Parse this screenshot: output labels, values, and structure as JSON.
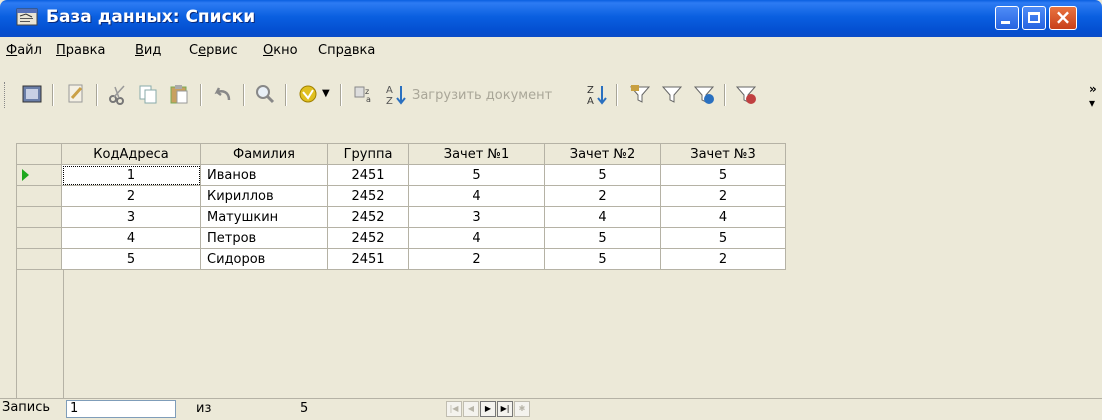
{
  "window": {
    "title": "База данных: Списки"
  },
  "menu": [
    {
      "label": "Файл",
      "accel": "Ф",
      "rest": "айл"
    },
    {
      "label": "Правка",
      "accel": "П",
      "rest": "равка"
    },
    {
      "label": "Вид",
      "accel": "В",
      "rest": "ид"
    },
    {
      "label": "Сервис",
      "pre": "С",
      "accel": "е",
      "rest": "рвис"
    },
    {
      "label": "Окно",
      "accel": "О",
      "rest": "кно"
    },
    {
      "label": "Справка",
      "pre": "Спр",
      "accel": "а",
      "rest": "вка"
    }
  ],
  "toolbar": {
    "load_document_label": "Загрузить документ"
  },
  "table": {
    "columns": [
      "КодАдреса",
      "Фамилия",
      "Группа",
      "Зачет №1",
      "Зачет №2",
      "Зачет №3"
    ],
    "rows": [
      [
        "1",
        "Иванов",
        "2451",
        "5",
        "5",
        "5"
      ],
      [
        "2",
        "Кириллов",
        "2452",
        "4",
        "2",
        "2"
      ],
      [
        "3",
        "Матушкин",
        "2452",
        "3",
        "4",
        "4"
      ],
      [
        "4",
        "Петров",
        "2452",
        "4",
        "5",
        "5"
      ],
      [
        "5",
        "Сидоров",
        "2451",
        "2",
        "5",
        "2"
      ]
    ]
  },
  "navigator": {
    "record_label": "Запись",
    "current_record": "1",
    "of_label": "из",
    "total": "5"
  },
  "colors": {
    "titlebar": "#0a5fe0",
    "window_bg": "#ece9d8",
    "current_row_marker": "#1ea81e",
    "close_button": "#d4502a"
  }
}
